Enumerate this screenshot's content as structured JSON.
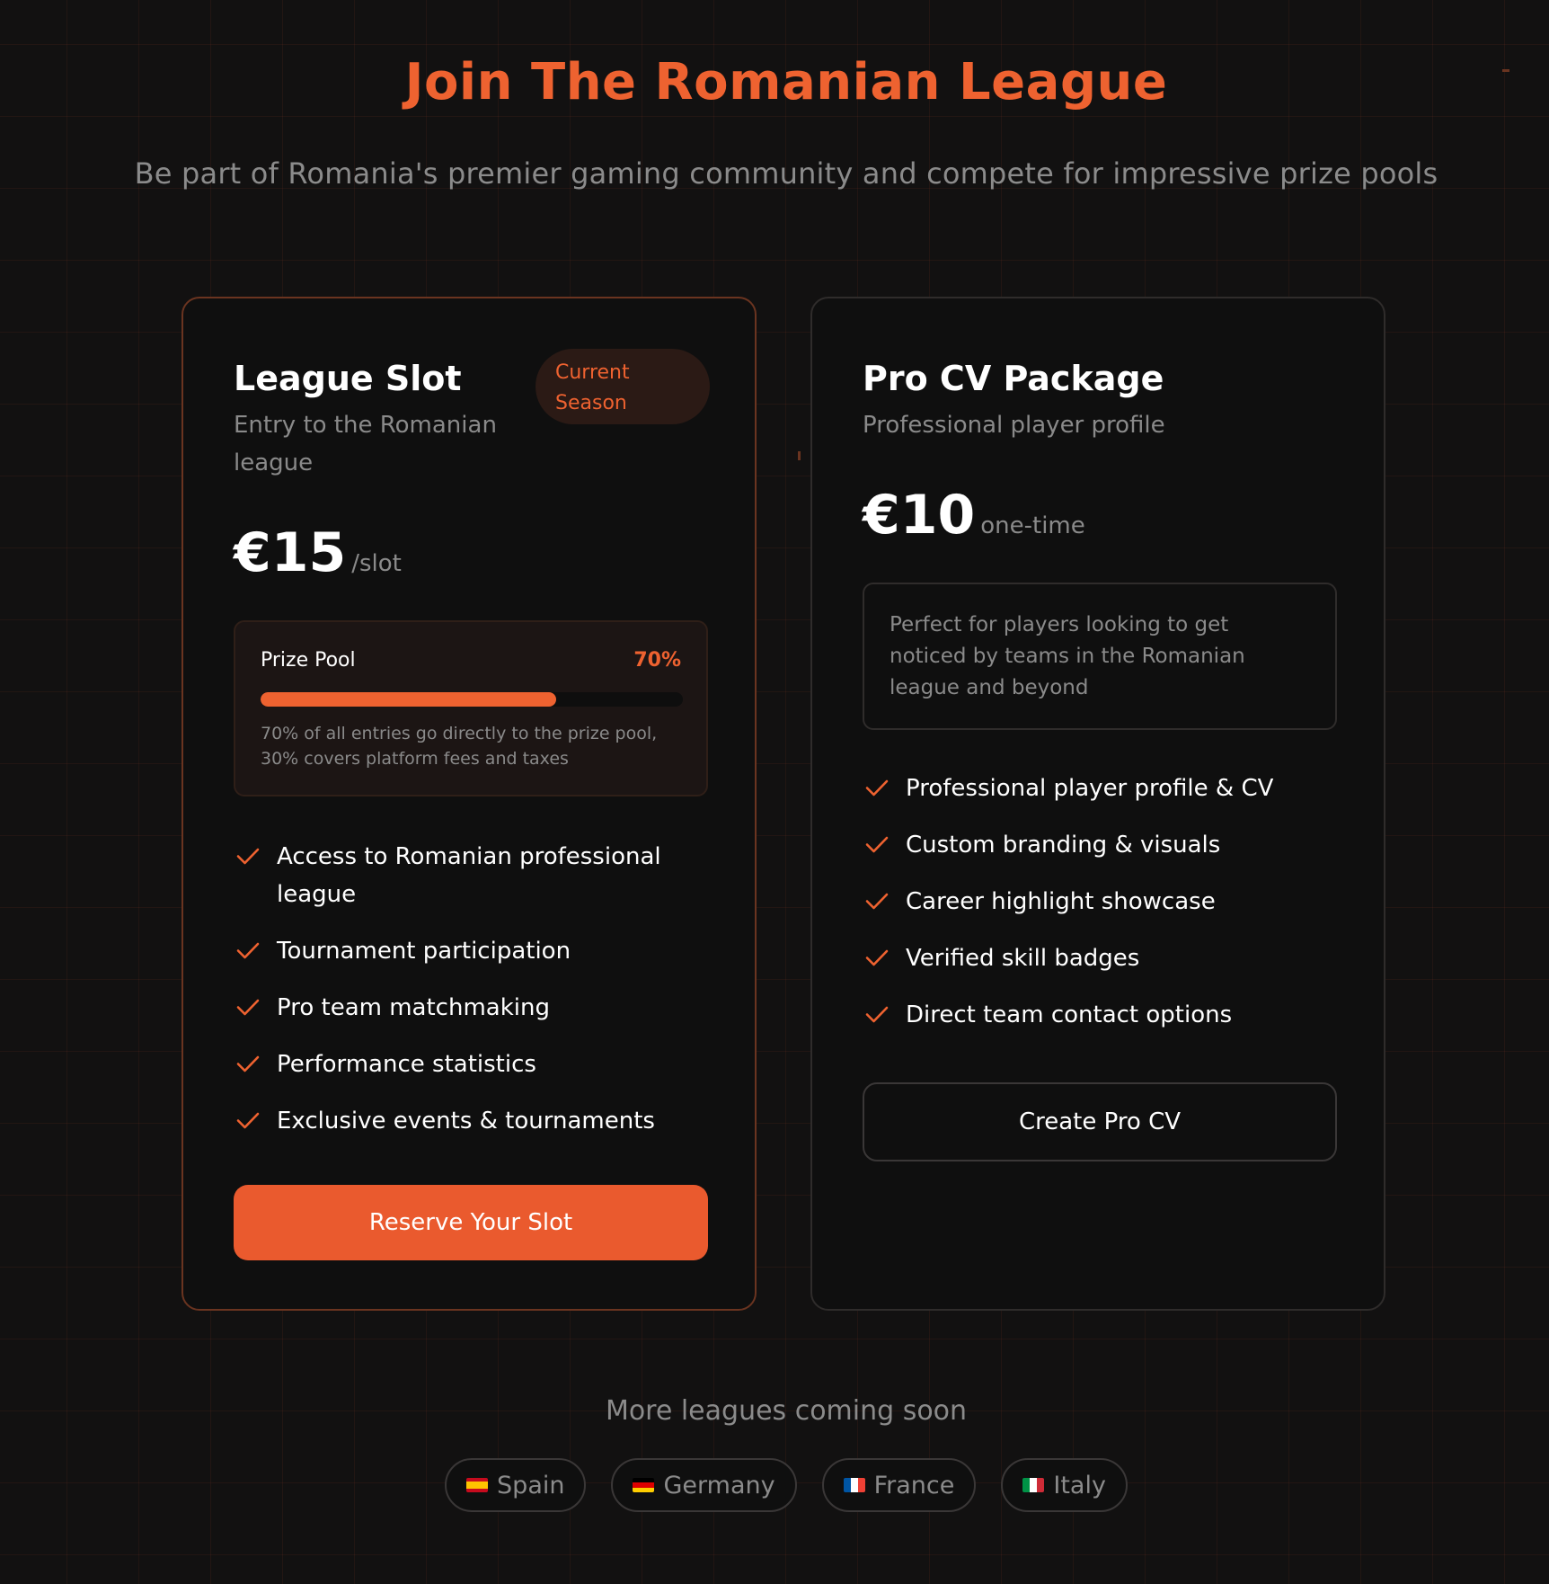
{
  "header": {
    "title": "Join The Romanian League",
    "subtitle": "Be part of Romania's premier gaming community and compete for impressive prize pools"
  },
  "cards": [
    {
      "title": "League Slot",
      "description": "Entry to the Romanian league",
      "badge": "Current Season",
      "price": "€15",
      "price_unit": "/slot",
      "prize_pool": {
        "label": "Prize Pool",
        "percent_label": "70%",
        "percent": 70,
        "note": "70% of all entries go directly to the prize pool, 30% covers platform fees and taxes"
      },
      "features": [
        "Access to Romanian professional league",
        "Tournament participation",
        "Pro team matchmaking",
        "Performance statistics",
        "Exclusive events & tournaments"
      ],
      "button_label": "Reserve Your Slot"
    },
    {
      "title": "Pro CV Package",
      "description": "Professional player profile",
      "price": "€10",
      "price_unit": "one-time",
      "info": "Perfect for players looking to get noticed by teams in the Romanian league and beyond",
      "features": [
        "Professional player profile & CV",
        "Custom branding & visuals",
        "Career highlight showcase",
        "Verified skill badges",
        "Direct team contact options"
      ],
      "button_label": "Create Pro CV"
    }
  ],
  "coming_soon": {
    "title": "More leagues coming soon",
    "countries": [
      {
        "name": "Spain",
        "flag": "flag-spain-icon"
      },
      {
        "name": "Germany",
        "flag": "flag-germany-icon"
      },
      {
        "name": "France",
        "flag": "flag-france-icon"
      },
      {
        "name": "Italy",
        "flag": "flag-italy-icon"
      }
    ]
  },
  "colors": {
    "accent": "#ee6230",
    "background": "#121111",
    "card": "#0f0f0f",
    "muted_text": "#8a8a8a"
  }
}
